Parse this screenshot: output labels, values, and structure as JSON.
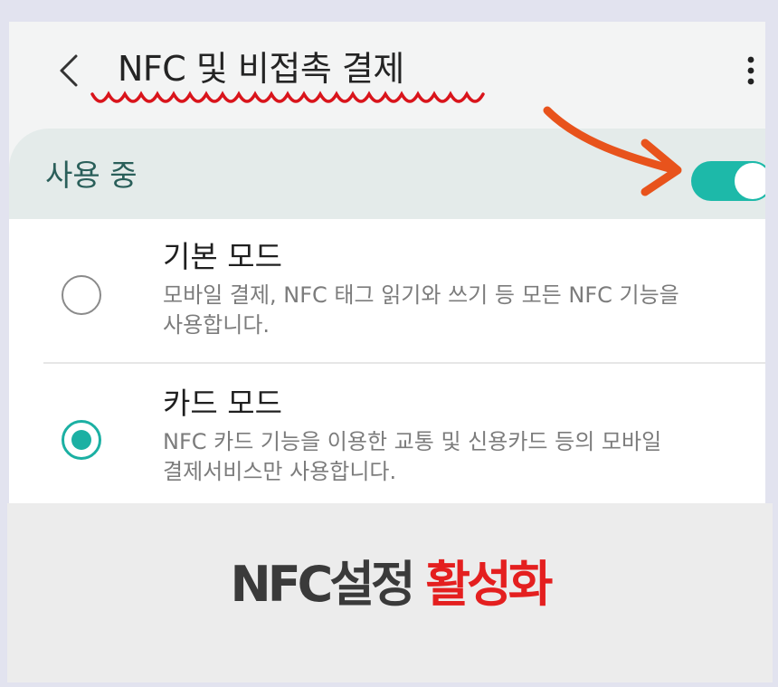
{
  "appbar": {
    "back_icon": "chevron-left-icon",
    "title": "NFC 및 비접촉 결제",
    "more_icon": "more-vertical-icon"
  },
  "master_switch": {
    "label": "사용 중",
    "enabled": true
  },
  "options": [
    {
      "title": "기본 모드",
      "description": "모바일 결제, NFC 태그 읽기와 쓰기 등 모든 NFC 기능을\n사용합니다.",
      "selected": false
    },
    {
      "title": "카드 모드",
      "description": "NFC 카드 기능을 이용한 교통 및 신용카드 등의 모바일\n결제서비스만 사용합니다.",
      "selected": true
    }
  ],
  "caption": {
    "part1": "NFC설정",
    "part2": "활성화"
  },
  "colors": {
    "accent": "#1db9a9",
    "annotation": "#e8531c",
    "caption_highlight": "#e41f1f",
    "header_band": "#e4ebea"
  }
}
